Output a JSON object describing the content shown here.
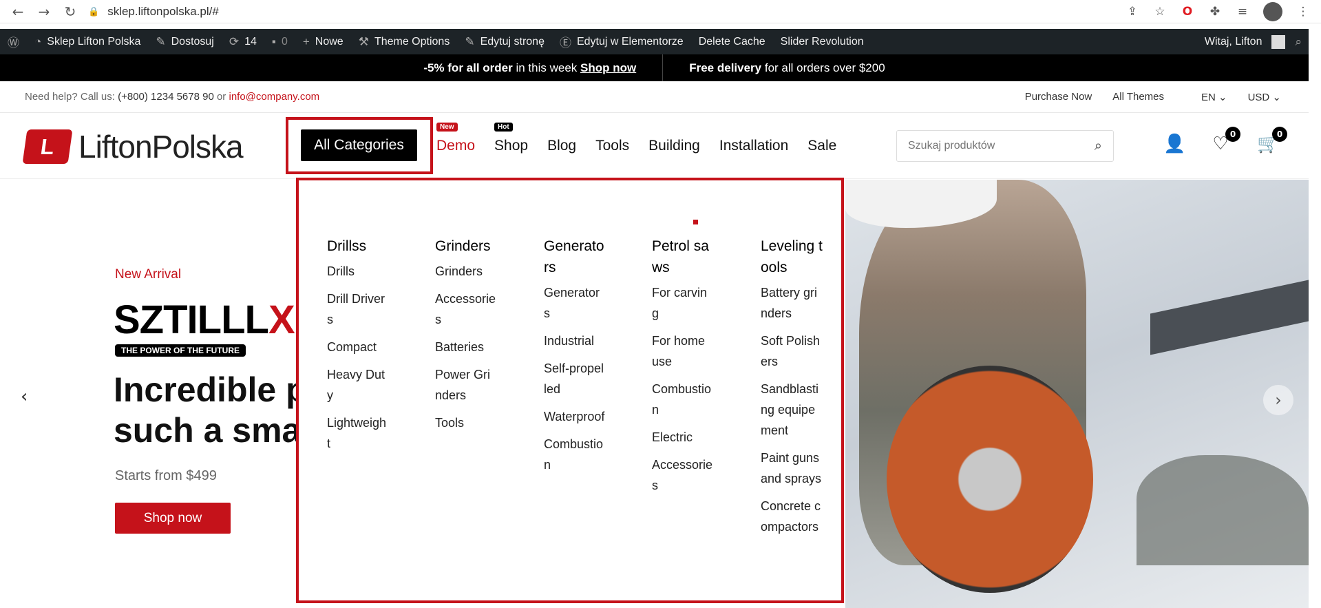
{
  "browser": {
    "url": "sklep.liftonpolska.pl/#"
  },
  "wpbar": {
    "site": "Sklep Lifton Polska",
    "customize": "Dostosuj",
    "updates": "14",
    "comments": "0",
    "new": "Nowe",
    "theme_options": "Theme Options",
    "edit_page": "Edytuj stronę",
    "edit_elementor": "Edytuj w Elementorze",
    "delete_cache": "Delete Cache",
    "slider": "Slider Revolution",
    "greeting": "Witaj, Lifton"
  },
  "promo": {
    "discount_bold": "-5% for all order",
    "discount_rest": " in this week ",
    "shop_now": "Shop now",
    "delivery_bold": "Free delivery",
    "delivery_rest": " for all orders over $200"
  },
  "topbar": {
    "help_prefix": "Need help? Call us: ",
    "phone": "(+800) 1234 5678 90",
    "or": " or ",
    "email": "info@company.com",
    "purchase": "Purchase Now",
    "themes": "All Themes",
    "lang": "EN ⌄",
    "currency": "USD ⌄"
  },
  "header": {
    "logo_text_a": "Lifton",
    "logo_text_b": "Polska",
    "all_categories": "All Categories",
    "menu": [
      {
        "label": "Demo",
        "badge": "New"
      },
      {
        "label": "Shop",
        "badge": "Hot"
      },
      {
        "label": "Blog",
        "badge": ""
      },
      {
        "label": "Tools",
        "badge": ""
      },
      {
        "label": "Building",
        "badge": ""
      },
      {
        "label": "Installation",
        "badge": ""
      },
      {
        "label": "Sale",
        "badge": ""
      }
    ],
    "search_placeholder": "Szukaj produktów",
    "wishlist_count": "0",
    "cart_count": "0"
  },
  "hero": {
    "new_arrival": "New Arrival",
    "brand_a": "SZTILLL",
    "brand_b": "X",
    "tagline": "THE POWER OF THE FUTURE",
    "headline_1": "Incredible p",
    "headline_2": "such a small",
    "price": "Starts from $499",
    "cta": "Shop now"
  },
  "mega_menu": {
    "columns": [
      {
        "title": "Drillss",
        "links": [
          "Drills",
          "Drill Drivers",
          "Compact",
          "Heavy Duty",
          "Lightweight"
        ]
      },
      {
        "title": "Grinders",
        "links": [
          "Grinders",
          "Accessories",
          "Batteries",
          "Power Grinders",
          "Tools"
        ]
      },
      {
        "title": "Generators",
        "links": [
          "Generators",
          "Industrial",
          "Self-propelled",
          "Waterproof",
          "Combustion"
        ]
      },
      {
        "title": "Petrol saws",
        "links": [
          "For carving",
          "For home use",
          "Combustion",
          "Electric",
          "Accessories"
        ]
      },
      {
        "title": "Leveling tools",
        "links": [
          "Battery grinders",
          "Soft Polishers",
          "Sandblasting equipement",
          "Paint guns and sprays",
          "Concrete compactors"
        ]
      }
    ]
  },
  "colors": {
    "accent": "#c5121a",
    "dark": "#000000",
    "wpbar": "#1d2327"
  }
}
